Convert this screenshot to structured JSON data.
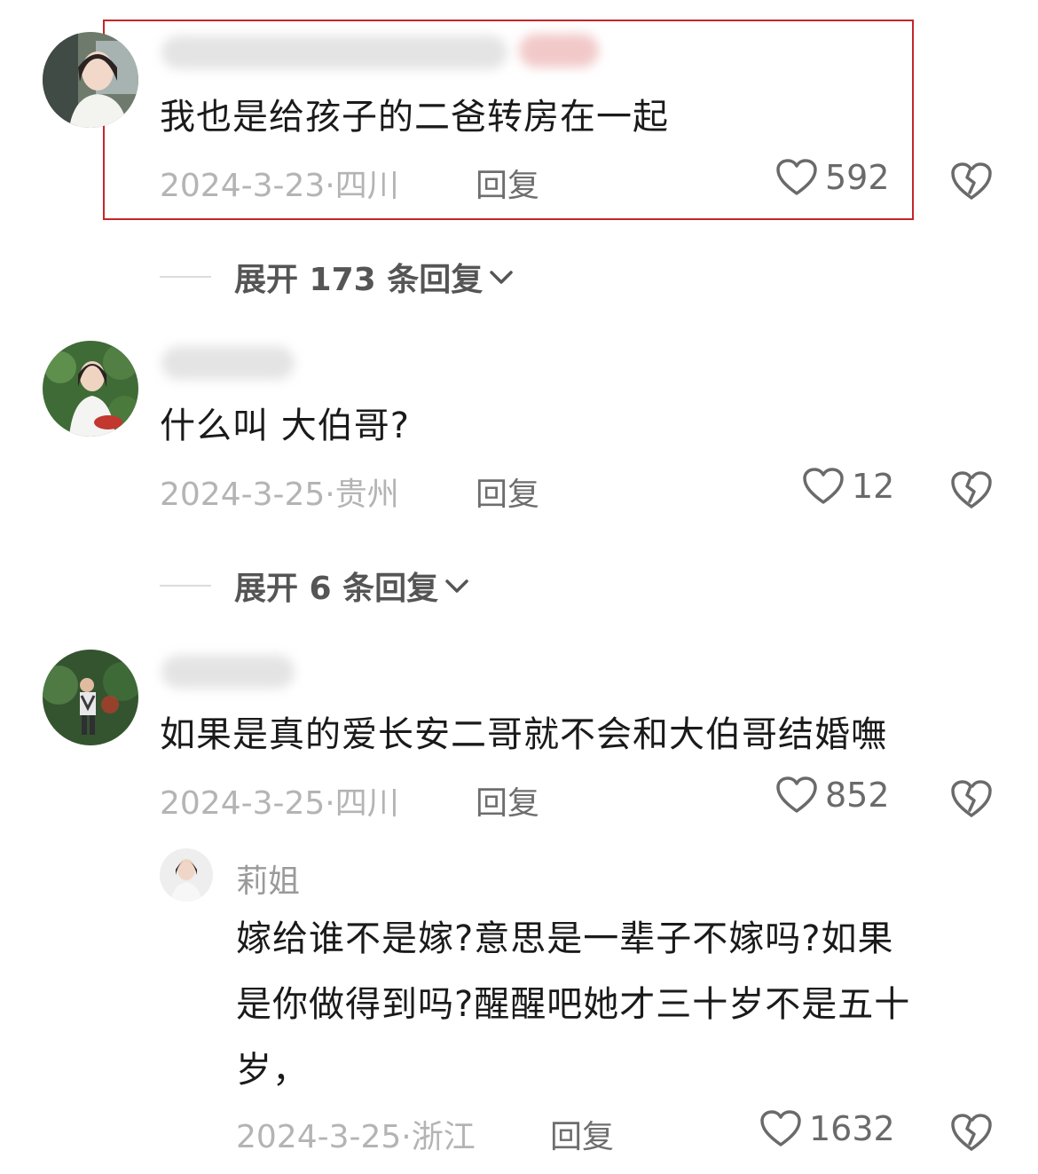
{
  "comments": [
    {
      "text": "我也是给孩子的二爸转房在一起",
      "date": "2024-3-23·",
      "location": "四川",
      "reply_label": "回复",
      "likes": "592",
      "expand_label": "展开 173 条回复"
    },
    {
      "text": "什么叫 大伯哥?",
      "date": "2024-3-25·",
      "location": "贵州",
      "reply_label": "回复",
      "likes": "12",
      "expand_label": "展开 6 条回复"
    },
    {
      "text": "如果是真的爱长安二哥就不会和大伯哥结婚嘸",
      "date": "2024-3-25·",
      "location": "四川",
      "reply_label": "回复",
      "likes": "852",
      "reply": {
        "username": "莉姐",
        "lines": [
          "嫁给谁不是嫁?意思是一辈子不嫁吗?如果",
          "是你做得到吗?醒醒吧她才三十岁不是五十",
          "岁，"
        ],
        "date": "2024-3-25·",
        "location": "浙江",
        "reply_label": "回复",
        "likes": "1632"
      }
    }
  ],
  "colors": {
    "highlight": "#c4262a",
    "meta": "#b4b4b4",
    "text": "#1a1a1a"
  },
  "icons": [
    "heart-outline-icon",
    "broken-heart-icon",
    "chevron-down-icon"
  ]
}
